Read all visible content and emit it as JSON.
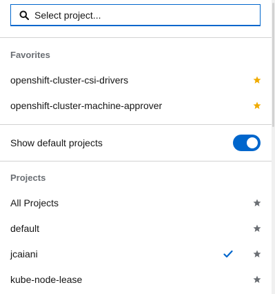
{
  "search": {
    "placeholder": "Select project..."
  },
  "favorites": {
    "title": "Favorites",
    "items": [
      {
        "label": "openshift-cluster-csi-drivers",
        "starred": true
      },
      {
        "label": "openshift-cluster-machine-approver",
        "starred": true
      }
    ]
  },
  "toggle": {
    "label": "Show default projects",
    "on": true
  },
  "projects": {
    "title": "Projects",
    "items": [
      {
        "label": "All Projects",
        "selected": false
      },
      {
        "label": "default",
        "selected": false
      },
      {
        "label": "jcaiani",
        "selected": true
      },
      {
        "label": "kube-node-lease",
        "selected": false
      }
    ]
  },
  "colors": {
    "accent": "#0066cc",
    "star_favorite": "#f0ab00",
    "star_default": "#6a6e73"
  }
}
